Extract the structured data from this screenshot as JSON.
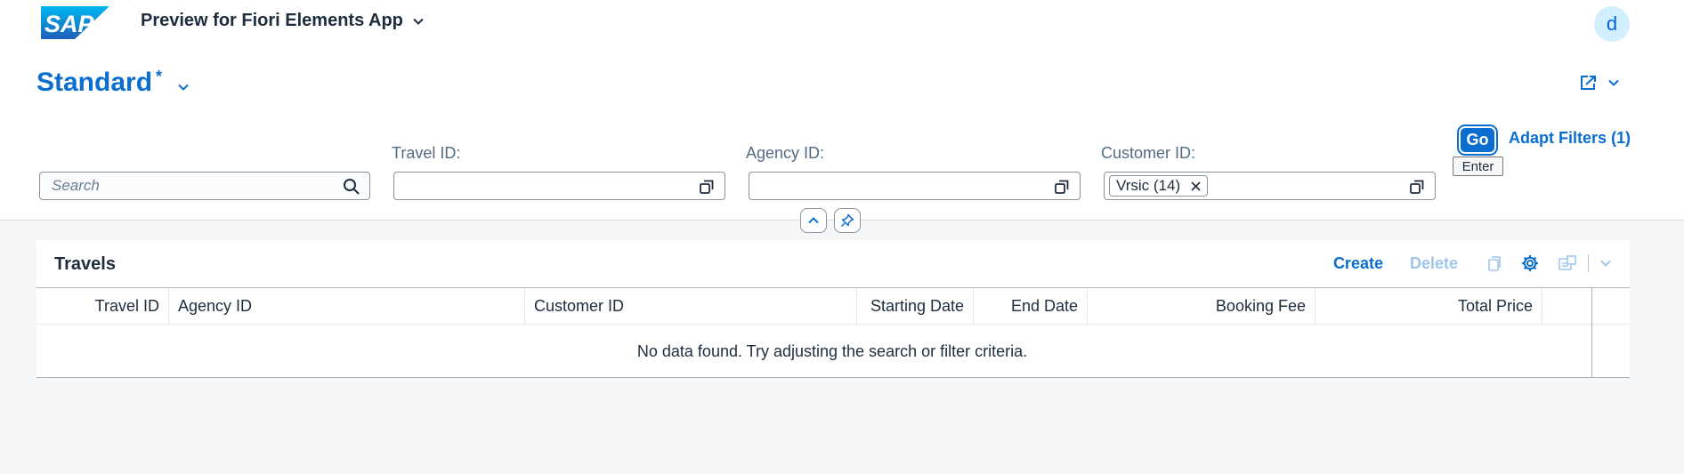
{
  "shell": {
    "logo_text": "SAP",
    "app_title": "Preview for Fiori Elements App",
    "user_initial": "d"
  },
  "header": {
    "variant_name": "Standard",
    "variant_modified": "*"
  },
  "filters": {
    "search_placeholder": "Search",
    "travel_id_label": "Travel ID:",
    "agency_id_label": "Agency ID:",
    "customer_id_label": "Customer ID:",
    "customer_token": "Vrsic (14)",
    "go_label": "Go",
    "go_tooltip": "Enter",
    "adapt_filters_label": "Adapt Filters (1)"
  },
  "table": {
    "title": "Travels",
    "create_label": "Create",
    "delete_label": "Delete",
    "columns": [
      "Travel ID",
      "Agency ID",
      "Customer ID",
      "Starting Date",
      "End Date",
      "Booking Fee",
      "Total Price"
    ],
    "no_data_text": "No data found. Try adjusting the search or filter criteria."
  },
  "colors": {
    "brand_blue": "#0a6ed1",
    "text": "#1d2d3e",
    "background": "#f5f6f7"
  }
}
